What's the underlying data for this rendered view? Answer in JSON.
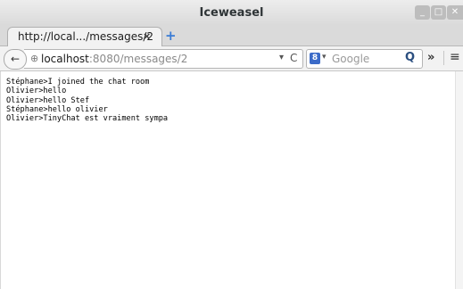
{
  "window": {
    "title": "Iceweasel",
    "min_icon": "_",
    "max_icon": "□",
    "close_icon": "✕"
  },
  "tab": {
    "label": "http://local.../messages/2",
    "close_glyph": "×",
    "new_tab_glyph": "+"
  },
  "nav": {
    "back_glyph": "←",
    "url_host": "localhost",
    "url_rest": ":8080/messages/2",
    "dropdown_glyph": "▾",
    "reload_glyph": "C",
    "search_engine_letter": "8",
    "search_placeholder": "Google",
    "search_glyph": "🔍",
    "overflow_glyph": "»",
    "menu_glyph": "≡"
  },
  "messages": [
    "Stéphane>I joined the chat room",
    "Olivier>hello",
    "Olivier>hello Stef",
    "Stéphane>hello olivier",
    "Olivier>TinyChat est vraiment sympa"
  ]
}
